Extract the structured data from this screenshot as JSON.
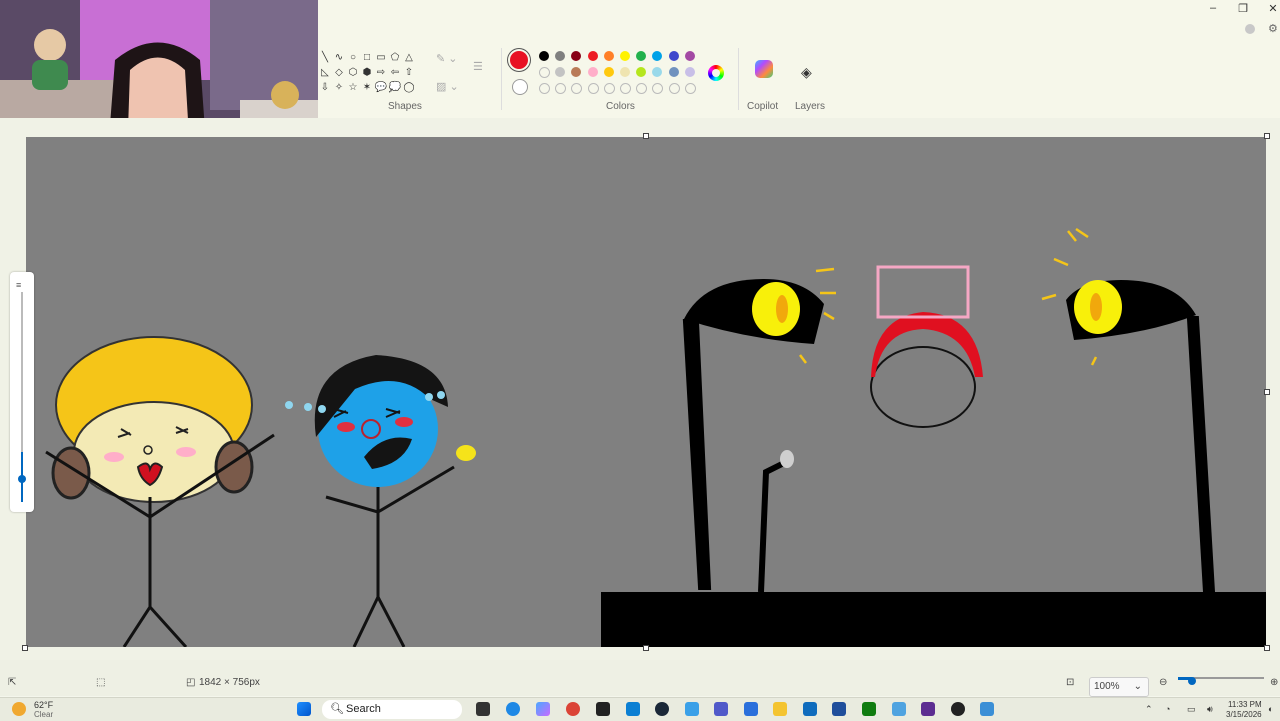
{
  "window": {
    "minimize": "–",
    "restore": "❐",
    "close": "✕"
  },
  "ribbon": {
    "shapes_label": "Shapes",
    "colors_label": "Colors",
    "copilot_label": "Copilot",
    "layers_label": "Layers",
    "shape_glyphs": [
      "╲",
      "∿",
      "○",
      "□",
      "▭",
      "⬠",
      "△",
      "◺",
      "◇",
      "⬡",
      "⬢",
      "⇨",
      "⇦",
      "⇧",
      "⇩",
      "✧",
      "☆",
      "✶",
      "💬",
      "💭",
      "◯"
    ],
    "colors_row1": [
      "#000000",
      "#7f7f7f",
      "#880015",
      "#ed1c24",
      "#ff7f27",
      "#fff200",
      "#22b14c",
      "#00a2e8",
      "#3f48cc",
      "#a349a4"
    ],
    "colors_row2": [
      "",
      "#c3c3c3",
      "#b97a57",
      "#ffaec9",
      "#ffc90e",
      "#efe4b0",
      "#b5e61d",
      "#99d9ea",
      "#7092be",
      "#c8bfe7"
    ],
    "colors_row3": [
      "",
      "",
      "",
      "",
      "",
      "",
      "",
      "",
      "",
      ""
    ],
    "primary_color": "#e81123",
    "secondary_color": "#ffffff"
  },
  "status": {
    "canvas_size": "1842 × 756px",
    "zoom": "100%"
  },
  "taskbar": {
    "weather_temp": "62°F",
    "weather_desc": "Clear",
    "search_placeholder": "Search",
    "time": "11:33 PM",
    "date": "3/15/2026"
  }
}
